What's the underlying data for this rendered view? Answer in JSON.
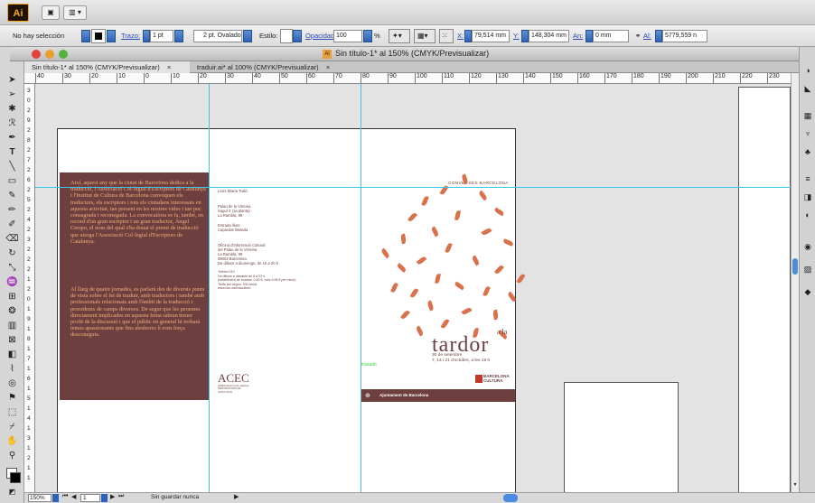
{
  "app": {
    "logo": "Ai",
    "btn1": "▣",
    "btn2": "▥ ▾"
  },
  "control": {
    "selection": "No hay selección",
    "stroke_label": "Trazo:",
    "stroke_value": "1 pt",
    "profile_value": "2 pt. Ovalado",
    "style_label": "Estilo:",
    "opacity_label": "Opacidad:",
    "opacity_value": "100",
    "percent": "%",
    "x_label": "X:",
    "x_value": "79,514 mm",
    "y_label": "Y:",
    "y_value": "148,304 mm",
    "w_label": "An:",
    "w_value": "0 mm",
    "h_label": "Al:",
    "h_value": "5779,559 n"
  },
  "window": {
    "title": "Sin título-1* al 150% (CMYK/Previsualizar)"
  },
  "tabs": [
    {
      "label": "Sin título-1* al 150% (CMYK/Previsualizar)",
      "close": "×"
    },
    {
      "label": "traduir.ai* al 100% (CMYK/Previsualizar)",
      "close": "×"
    }
  ],
  "ruler": {
    "h_ticks": [
      "40",
      "30",
      "20",
      "10",
      "0",
      "10",
      "20",
      "30",
      "40",
      "50",
      "60",
      "70",
      "80",
      "90",
      "100",
      "110",
      "120",
      "130",
      "140",
      "150",
      "160",
      "170",
      "180",
      "190",
      "200",
      "210",
      "220",
      "230"
    ],
    "v_ticks": [
      "3",
      "0",
      "2",
      "9",
      "2",
      "8",
      "2",
      "7",
      "2",
      "6",
      "2",
      "5",
      "2",
      "4",
      "2",
      "3",
      "2",
      "2",
      "2",
      "1",
      "2",
      "0",
      "1",
      "9",
      "1",
      "8",
      "1",
      "7",
      "1",
      "6",
      "1",
      "5",
      "1",
      "4",
      "1",
      "3",
      "1",
      "2",
      "1",
      "1"
    ]
  },
  "doc": {
    "left_text_1": "Així, aquest any que la ciutat de Barcelona dedica a la traducció, l'Associació Col·legial d'Escriptors de Catalunya i l'Institut de Cultura de Barcelona convoquen els traductors, els escriptors i tots els ciutadans interessats en aquesta activitat, tan present en les nostres vides i tan poc consagrada i reconeguda. La convocatòria es fa, també, en record d'un gran escriptor i un gran traductor, Àngel Crespo, el nom del qual s'ha donat el premi de traducció que atorga l'Associació Col·legial d'Escriptors de Catalunya.",
    "left_text_2": "Al llarg de quatre jornades, es parlarà des de diversis punts de vista sobre el fet de traduir, amb traductors i també amb professionals relacionats amb l'àmbit de la traducció i procedents de camps diversos. De segur que les persones directament implicades en aquesta feina sabran treure profit de la discussió i que el públic en general hi trobarà temes apassionants que fins aleshores li eren força desconeguts.",
    "mid_name": "Lluís Maria Todó",
    "mid_place": "Palau de la Virreina\nSaguí 4 (1a planta)\nLa Rambla, 99",
    "mid_entry": "Entrada lliure\nCapacitat limitada",
    "mid_info": "Oficina d'Informació Cultural\ndel Palau de la Virreina\nLa Rambla, 99\n08002 Barcelona\nDe dilluns a diumenge, de 10 a 20 h",
    "mid_phone": "Telèfon 010\nDe dilluns a dissabte de 8 a 22 h\n(establiment de trucada: 0,45 €, més 0,08 € per minut)\nTarifa per segon. IVA inclòs\nwww.bcn.cat/ciaculture",
    "acec": "ACEC",
    "acec_sub": "ASSOCIACIÓ COL·LEGIAL\nD'ESCRIPTORS DE\nCATALUNYA",
    "header_right": "CONVERSES  BARCELONA",
    "tardor_pre": "a la",
    "tardor": "tardor",
    "dates": "30 de setembre\n7, 14 i 21 d'octubre, a les 19 h",
    "guide_label": "trazado",
    "bcn_cultura": "BARCELONA\nCULTURA",
    "ajuntament": "Ajuntament de Barcelona"
  },
  "status": {
    "zoom": "150%",
    "page": "1",
    "info": "Sin guardar nunca"
  },
  "colors": {
    "brand": "#6e3f3f",
    "accent": "#d8714c",
    "title_color": "#6e3f3f",
    "guide": "#39c6e8"
  }
}
